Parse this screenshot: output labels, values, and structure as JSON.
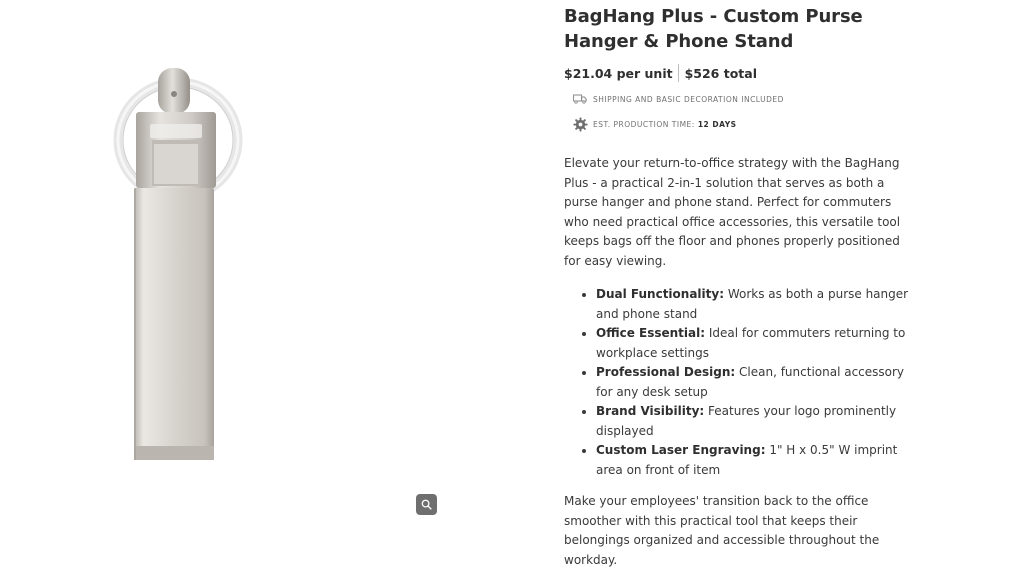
{
  "product": {
    "title": "BagHang Plus - Custom Purse Hanger & Phone Stand",
    "price_per_unit": "$21.04 per unit",
    "price_total": "$526 total"
  },
  "meta": {
    "shipping": "Shipping and basic decoration included",
    "production_label": "Est. production time:",
    "production_value": "12 days"
  },
  "description": "Elevate your return-to-office strategy with the BagHang Plus - a practical 2-in-1 solution that serves as both a purse hanger and phone stand. Perfect for commuters who need practical office accessories, this versatile tool keeps bags off the floor and phones properly positioned for easy viewing.",
  "features": [
    {
      "label": "Dual Functionality:",
      "text": "Works as both a purse hanger and phone stand"
    },
    {
      "label": "Office Essential:",
      "text": "Ideal for commuters returning to workplace settings"
    },
    {
      "label": "Professional Design:",
      "text": "Clean, functional accessory for any desk setup"
    },
    {
      "label": "Brand Visibility:",
      "text": "Features your logo prominently displayed"
    },
    {
      "label": "Custom Laser Engraving:",
      "text": "1\" H x 0.5\" W imprint area on front of item"
    }
  ],
  "closing": "Make your employees' transition back to the office smoother with this practical tool that keeps their belongings organized and accessible throughout the workday.",
  "icons": {
    "shipping": "truck-icon",
    "production": "gear-icon",
    "zoom": "magnifier-icon"
  },
  "colors": {
    "zoom_button": "#6f6f6f",
    "metal": "#d6d2cd"
  }
}
